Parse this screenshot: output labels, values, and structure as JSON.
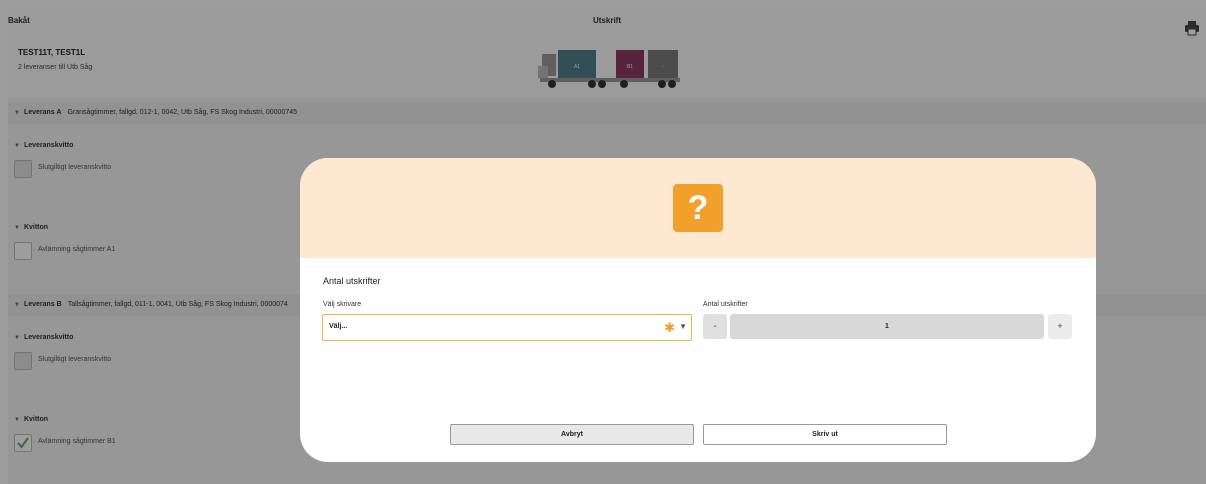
{
  "header": {
    "back_label": "Bakåt",
    "title": "Utskrift",
    "printer_icon": "printer-icon",
    "vehicle_name": "TEST11T, TEST1L",
    "vehicle_sub": "2 leveranser till Utb Såg",
    "truck_loads": [
      "A1",
      "B1",
      "-"
    ],
    "load_colors": [
      "#4f7f8d",
      "#8c3c63",
      "#7a7a7a"
    ]
  },
  "deliveries": [
    {
      "name": "Leverans A",
      "details": "Gransågtimmer, fallgd, 012-1, 0042, Utb Såg, FS Skog Industri, 00000745",
      "receipt_header": "Leveranskvitto",
      "receipt_item": "Slutgiltigt leveranskvitto",
      "kvitton_header": "Kvitton",
      "kvitton_item": "Avlämning sågtimmer A1",
      "kvitton_checked": false
    },
    {
      "name": "Leverans B",
      "details": "Tallsågtimmer, fallgd, 011-1, 0041, Utb Såg, FS Skog Industri, 0000074",
      "receipt_header": "Leveranskvitto",
      "receipt_item": "Slutgiltigt leveranskvitto",
      "kvitton_header": "Kvitton",
      "kvitton_item": "Avlämning sågtimmer B1",
      "kvitton_checked": true
    }
  ],
  "dialog": {
    "icon": "question-icon",
    "icon_glyph": "?",
    "title": "Antal utskrifter",
    "printer_label": "Välj skrivare",
    "printer_value": "Välj...",
    "required_mark": "✱",
    "dropdown_arrow": "▼",
    "count_label": "Antal utskrifter",
    "count_minus": "-",
    "count_value": "1",
    "count_plus": "+",
    "cancel_label": "Avbryt",
    "print_label": "Skriv ut"
  },
  "colors": {
    "accent": "#f2a02c",
    "modal_header_bg": "#fde8d2",
    "check_green": "#6aa84f"
  }
}
